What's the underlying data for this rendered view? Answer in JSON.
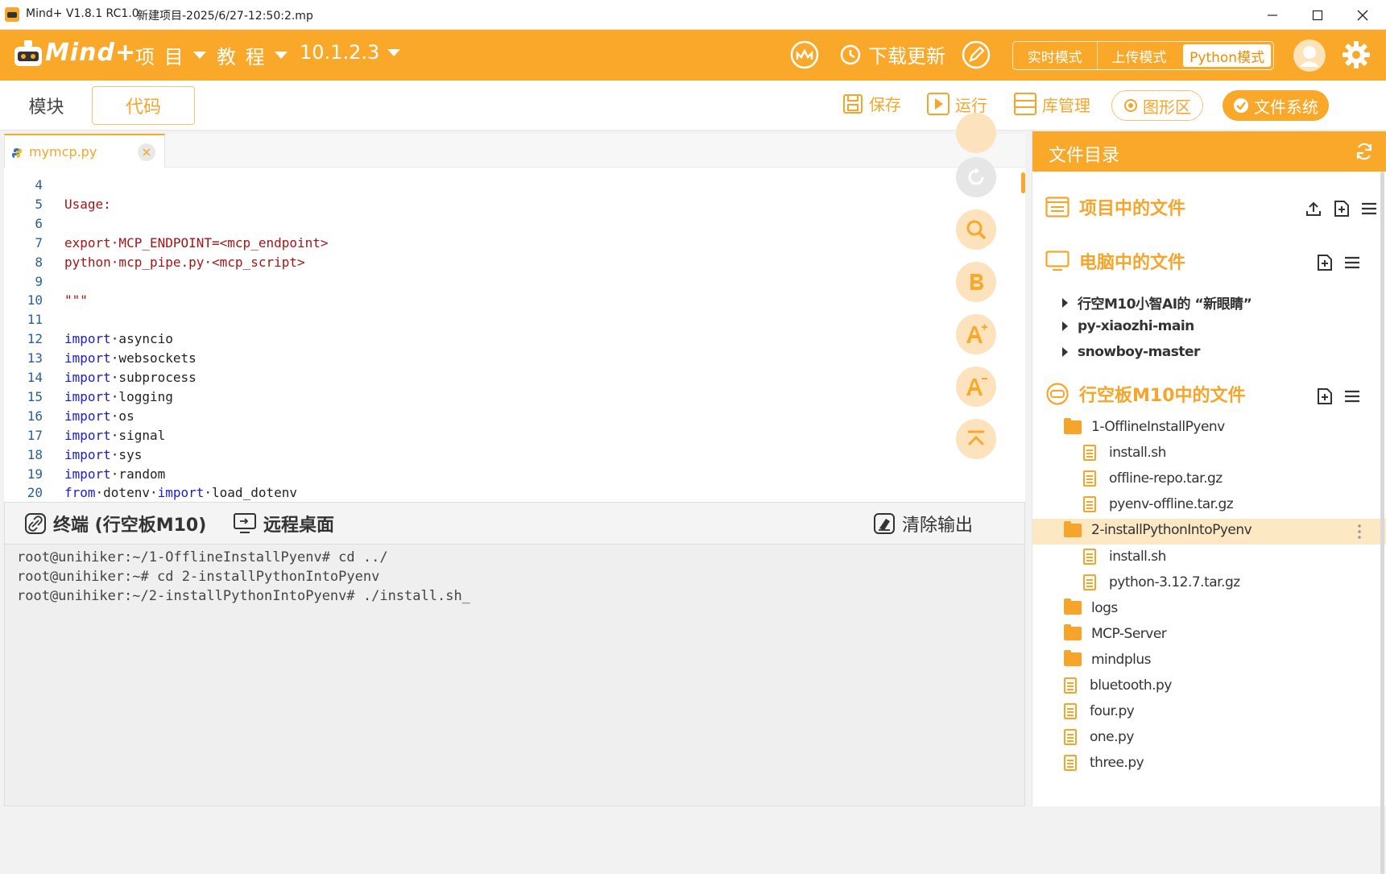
{
  "window": {
    "app_title": "Mind+ V1.8.1 RC1.0",
    "project_title": "新建项目-2025/6/27-12:50:2.mp"
  },
  "topbar": {
    "brand": "Mind+",
    "menu_project": "项 目",
    "menu_tutorial": "教 程",
    "menu_ip": "10.1.2.3",
    "download_update": "下载更新",
    "mode_realtime": "实时模式",
    "mode_upload": "上传模式",
    "mode_python": "Python模式"
  },
  "subbar": {
    "tab_blocks": "模块",
    "tab_code": "代码",
    "save": "保存",
    "run": "运行",
    "library": "库管理",
    "graphics": "图形区",
    "filesystem": "文件系统"
  },
  "editor": {
    "file_tab": "mymcp.py",
    "lines": [
      {
        "n": "4",
        "parts": []
      },
      {
        "n": "5",
        "parts": [
          {
            "t": "Usage:",
            "c": "str"
          }
        ]
      },
      {
        "n": "6",
        "parts": []
      },
      {
        "n": "7",
        "parts": [
          {
            "t": "export·MCP_ENDPOINT=<mcp_endpoint>",
            "c": "str"
          }
        ]
      },
      {
        "n": "8",
        "parts": [
          {
            "t": "python·mcp_pipe.py·<mcp_script>",
            "c": "str"
          }
        ]
      },
      {
        "n": "9",
        "parts": []
      },
      {
        "n": "10",
        "parts": [
          {
            "t": "\"\"\"",
            "c": "str"
          }
        ]
      },
      {
        "n": "11",
        "parts": []
      },
      {
        "n": "12",
        "parts": [
          {
            "t": "import",
            "c": "kw"
          },
          {
            "t": "·asyncio",
            "c": "plain"
          }
        ]
      },
      {
        "n": "13",
        "parts": [
          {
            "t": "import",
            "c": "kw"
          },
          {
            "t": "·websockets",
            "c": "plain"
          }
        ]
      },
      {
        "n": "14",
        "parts": [
          {
            "t": "import",
            "c": "kw"
          },
          {
            "t": "·subprocess",
            "c": "plain"
          }
        ]
      },
      {
        "n": "15",
        "parts": [
          {
            "t": "import",
            "c": "kw"
          },
          {
            "t": "·logging",
            "c": "plain"
          }
        ]
      },
      {
        "n": "16",
        "parts": [
          {
            "t": "import",
            "c": "kw"
          },
          {
            "t": "·os",
            "c": "plain"
          }
        ]
      },
      {
        "n": "17",
        "parts": [
          {
            "t": "import",
            "c": "kw"
          },
          {
            "t": "·signal",
            "c": "plain"
          }
        ]
      },
      {
        "n": "18",
        "parts": [
          {
            "t": "import",
            "c": "kw"
          },
          {
            "t": "·sys",
            "c": "plain"
          }
        ]
      },
      {
        "n": "19",
        "parts": [
          {
            "t": "import",
            "c": "kw"
          },
          {
            "t": "·random",
            "c": "plain"
          }
        ]
      },
      {
        "n": "20",
        "parts": [
          {
            "t": "from",
            "c": "kw"
          },
          {
            "t": "·dotenv·",
            "c": "plain"
          },
          {
            "t": "import",
            "c": "kw"
          },
          {
            "t": "·load_dotenv",
            "c": "plain"
          }
        ]
      }
    ]
  },
  "terminal": {
    "tab_terminal": "终端 (行空板M10)",
    "tab_remote": "远程桌面",
    "clear_output": "清除输出",
    "lines": [
      "root@unihiker:~/1-OfflineInstallPyenv# cd ../",
      "root@unihiker:~# cd 2-installPythonIntoPyenv",
      "root@unihiker:~/2-installPythonIntoPyenv# ./install.sh_"
    ]
  },
  "files": {
    "title": "文件目录",
    "section_project": "项目中的文件",
    "section_computer": "电脑中的文件",
    "section_board": "行空板M10中的文件",
    "computer_items": [
      "行空M10小智AI的 “新眼睛”",
      "py-xiaozhi-main",
      "snowboy-master"
    ],
    "board_items": [
      {
        "name": "1-OfflineInstallPyenv",
        "type": "folder",
        "level": 0
      },
      {
        "name": "install.sh",
        "type": "file",
        "level": 1
      },
      {
        "name": "offline-repo.tar.gz",
        "type": "file",
        "level": 1
      },
      {
        "name": "pyenv-offline.tar.gz",
        "type": "file",
        "level": 1
      },
      {
        "name": "2-installPythonIntoPyenv",
        "type": "folder",
        "level": 0,
        "selected": true
      },
      {
        "name": "install.sh",
        "type": "file",
        "level": 1
      },
      {
        "name": "python-3.12.7.tar.gz",
        "type": "file",
        "level": 1
      },
      {
        "name": "logs",
        "type": "folder",
        "level": 0
      },
      {
        "name": "MCP-Server",
        "type": "folder",
        "level": 0
      },
      {
        "name": "mindplus",
        "type": "folder",
        "level": 0
      },
      {
        "name": "bluetooth.py",
        "type": "file",
        "level": 0
      },
      {
        "name": "four.py",
        "type": "file",
        "level": 0
      },
      {
        "name": "one.py",
        "type": "file",
        "level": 0
      },
      {
        "name": "three.py",
        "type": "file",
        "level": 0
      }
    ]
  },
  "colors": {
    "accent": "#f9a82a",
    "keyword": "#1b1bd3",
    "string": "#a31515",
    "line_number": "#2b5f94"
  }
}
